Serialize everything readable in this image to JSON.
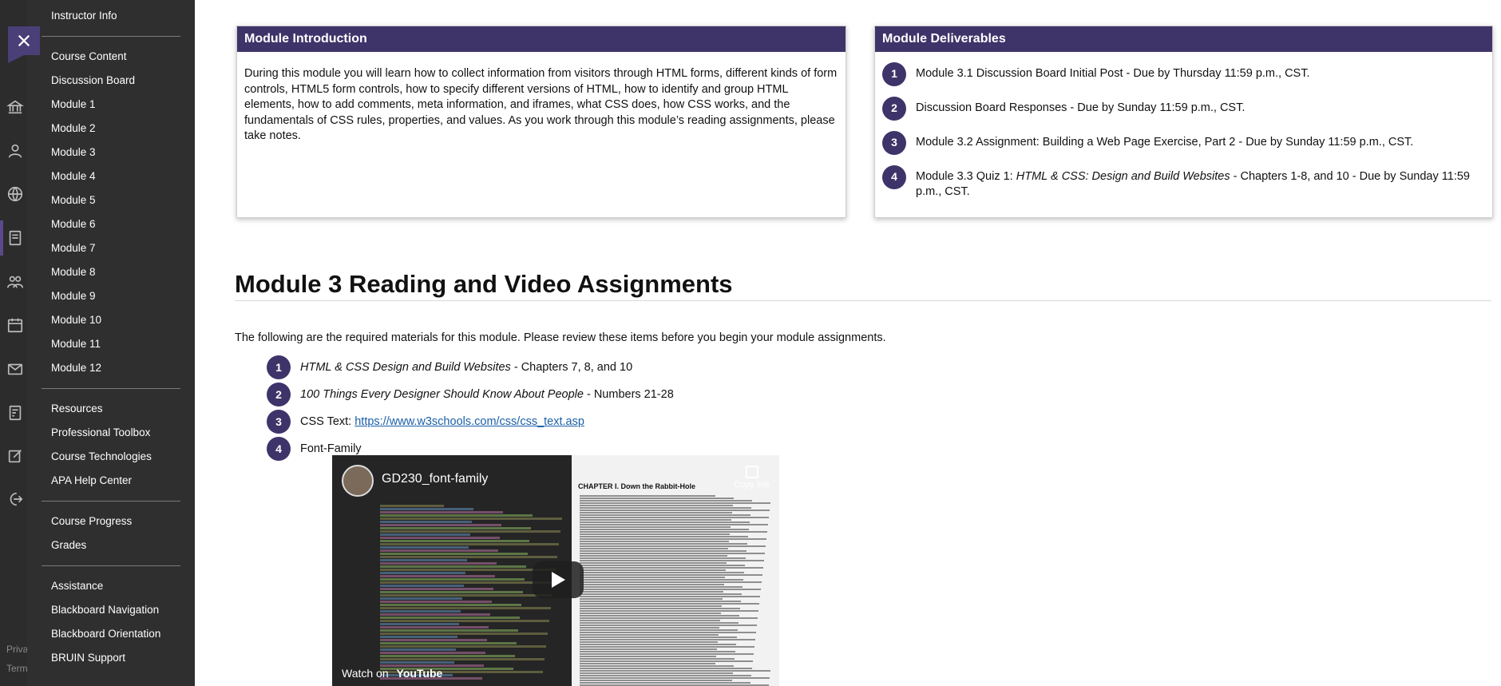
{
  "rail": {
    "icons": [
      "institution-icon",
      "user-icon",
      "globe-icon",
      "courses-icon",
      "groups-icon",
      "calendar-icon",
      "mail-icon",
      "grades-icon",
      "edit-icon",
      "signout-icon"
    ],
    "footer_lines": [
      "Priva",
      "Term"
    ]
  },
  "close_label": "×",
  "menu": {
    "groups": [
      [
        "Instructor Info"
      ],
      [
        "Course Content",
        "Discussion Board",
        "Module 1",
        "Module 2",
        "Module 3",
        "Module 4",
        "Module 5",
        "Module 6",
        "Module 7",
        "Module 8",
        "Module 9",
        "Module 10",
        "Module 11",
        "Module 12"
      ],
      [
        "Resources",
        "Professional Toolbox",
        "Course Technologies",
        "APA Help Center"
      ],
      [
        "Course Progress",
        "Grades"
      ],
      [
        "Assistance",
        "Blackboard Navigation",
        "Blackboard Orientation",
        "BRUIN Support"
      ]
    ]
  },
  "intro": {
    "title": "Module Introduction",
    "body": "During this module you will learn how to collect information from visitors through HTML forms, different kinds of form controls, HTML5 form controls, how to specify different versions of HTML, how to identify and group HTML elements, how to add comments, meta information, and iframes, what CSS does, how CSS works, and the fundamentals of CSS rules, properties, and values. As you work through this module’s reading assignments, please take notes."
  },
  "deliverables": {
    "title": "Module Deliverables",
    "items": [
      {
        "num": "1",
        "text": "Module 3.1 Discussion Board Initial Post - Due by Thursday 11:59 p.m., CST."
      },
      {
        "num": "2",
        "text": "Discussion Board Responses - Due by Sunday 11:59 p.m., CST."
      },
      {
        "num": "3",
        "text": "Module 3.2 Assignment: Building a Web Page Exercise, Part 2 - Due by Sunday 11:59 p.m., CST."
      },
      {
        "num": "4",
        "prefix": "Module 3.3 Quiz 1: ",
        "italic": "HTML & CSS: Design and Build Websites",
        "suffix": " - Chapters 1-8, and 10 - Due by Sunday 11:59 p.m., CST."
      }
    ]
  },
  "section": {
    "title": "Module 3 Reading and Video Assignments",
    "intro": "The following are the required materials for this module. Please review these items before you begin your module assignments."
  },
  "readings": [
    {
      "num": "1",
      "italic": "HTML & CSS Design and Build Websites",
      "suffix": " - Chapters 7, 8, and 10"
    },
    {
      "num": "2",
      "italic": "100 Things Every Designer Should Know About People",
      "suffix": " - Numbers 21-28"
    },
    {
      "num": "3",
      "prefix": "CSS Text: ",
      "link": "https://www.w3schools.com/css/css_text.asp"
    },
    {
      "num": "4",
      "prefix": "Font-Family"
    }
  ],
  "video": {
    "title": "GD230_font-family",
    "copy_label": "Copy link",
    "watch_label": "Watch on",
    "brand": "YouTube",
    "chapter_heading": "CHAPTER I. Down the Rabbit-Hole"
  },
  "colors": {
    "accent": "#3f3469",
    "menu_bg": "#2f2f2f",
    "rail_bg": "#2c2c2c",
    "link": "#1a5fa8"
  }
}
